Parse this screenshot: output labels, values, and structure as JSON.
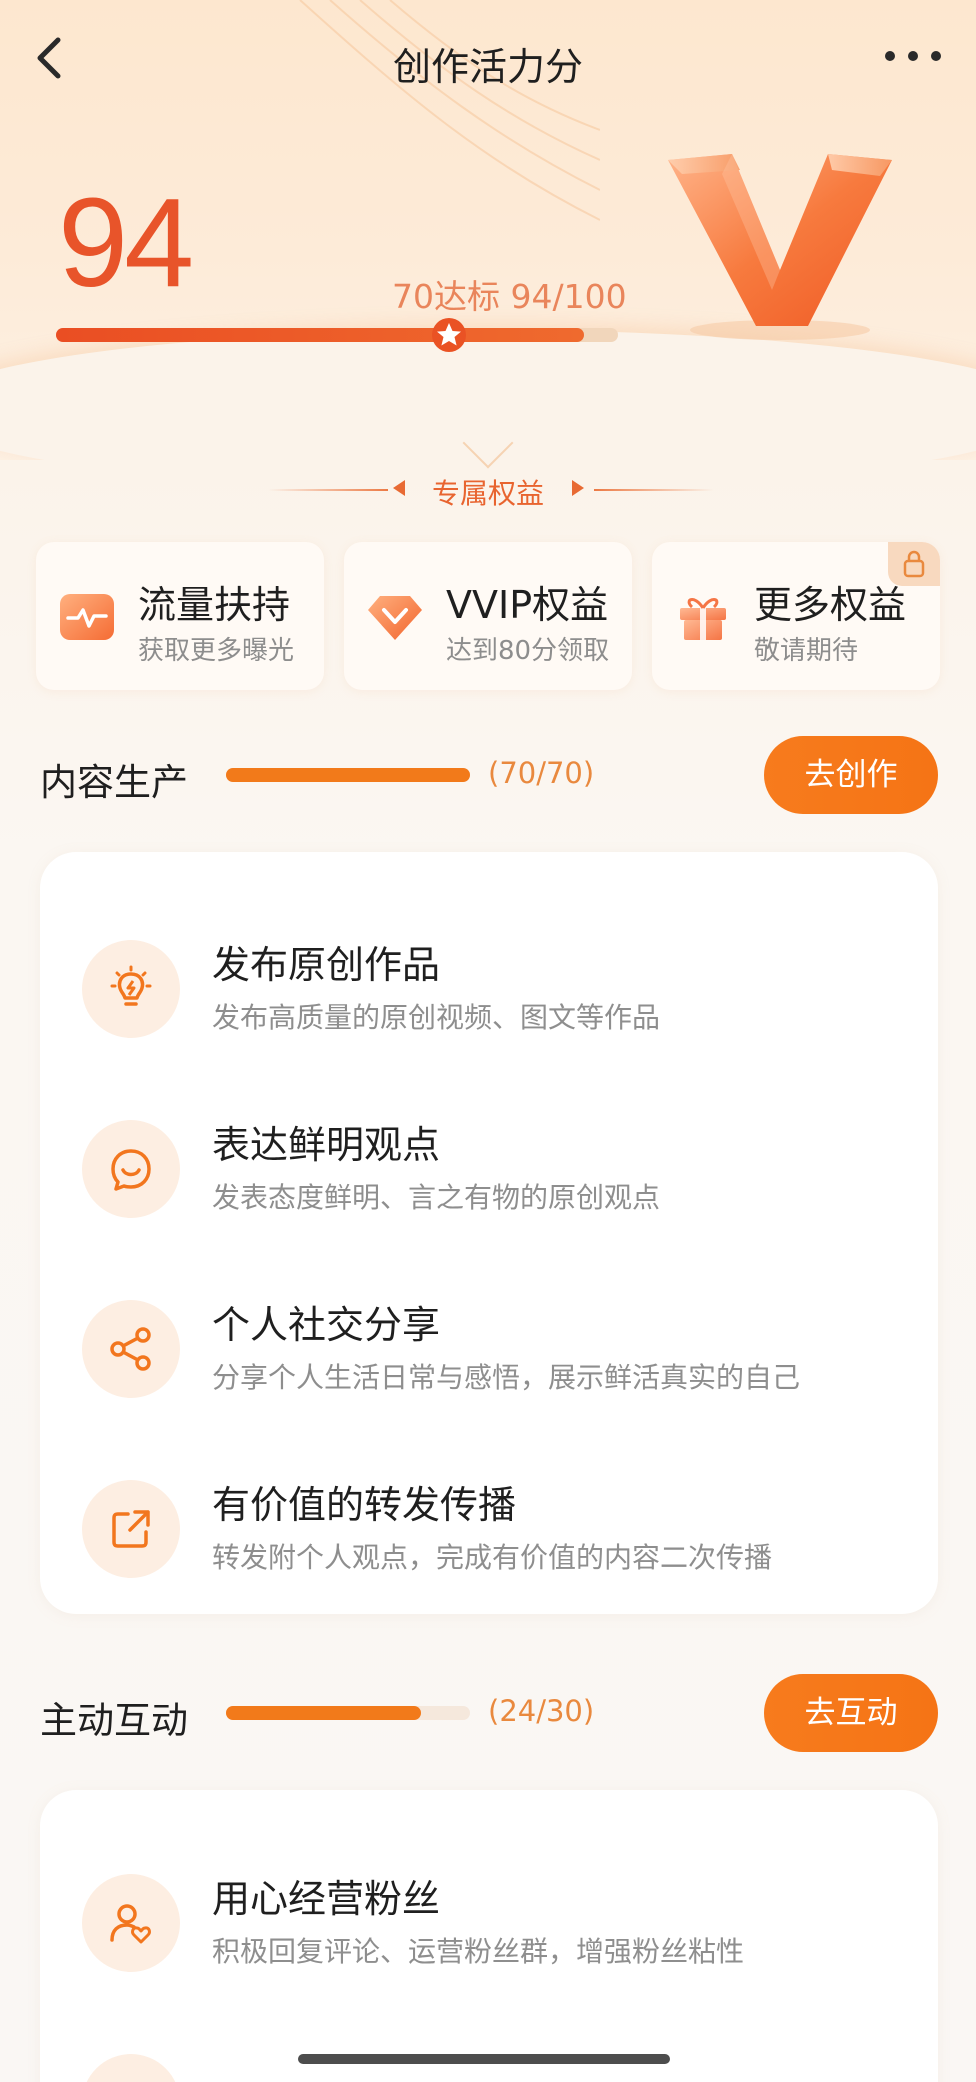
{
  "nav": {
    "title": "创作活力分",
    "back_icon": "chevron-left-icon",
    "more_icon": "more-horizontal-icon"
  },
  "score": {
    "value": "94",
    "target_text": "70达标 94/100",
    "progress": 0.94,
    "star_position": 0.7
  },
  "benefits": {
    "header": "专属权益",
    "items": [
      {
        "title": "流量扶持",
        "subtitle": "获取更多曝光",
        "icon": "pulse-icon"
      },
      {
        "title": "VVIP权益",
        "subtitle": "达到80分领取",
        "icon": "diamond-icon"
      },
      {
        "title": "更多权益",
        "subtitle": "敬请期待",
        "icon": "gift-icon",
        "locked": true
      }
    ]
  },
  "sections": [
    {
      "title": "内容生产",
      "count": "(70/70)",
      "progress": 1.0,
      "button": "去创作",
      "items": [
        {
          "title": "发布原创作品",
          "subtitle": "发布高质量的原创视频、图文等作品",
          "icon": "lightbulb-icon"
        },
        {
          "title": "表达鲜明观点",
          "subtitle": "发表态度鲜明、言之有物的原创观点",
          "icon": "smile-bubble-icon"
        },
        {
          "title": "个人社交分享",
          "subtitle": "分享个人生活日常与感悟，展示鲜活真实的自己",
          "icon": "share-icon"
        },
        {
          "title": "有价值的转发传播",
          "subtitle": "转发附个人观点，完成有价值的内容二次传播",
          "icon": "forward-icon"
        }
      ]
    },
    {
      "title": "主动互动",
      "count": "(24/30)",
      "progress": 0.8,
      "button": "去互动",
      "items": [
        {
          "title": "用心经营粉丝",
          "subtitle": "积极回复评论、运营粉丝群，增强粉丝粘性",
          "icon": "user-heart-icon"
        }
      ]
    }
  ],
  "colors": {
    "accent": "#f57a1b",
    "score": "#e8542a",
    "track": "#f5e8dc"
  }
}
